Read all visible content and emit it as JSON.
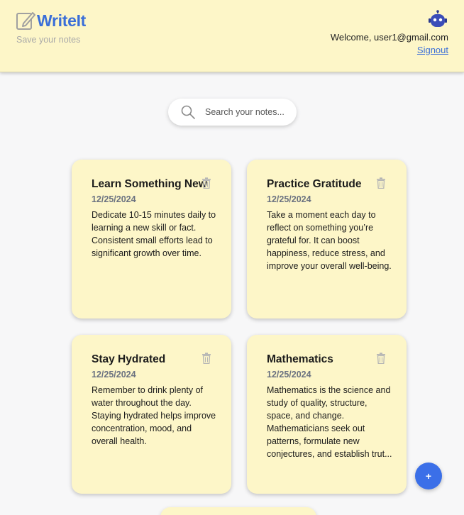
{
  "header": {
    "brand_title": "WriteIt",
    "tagline": "Save your notes",
    "welcome": "Welcome, user1@gmail.com",
    "signout_label": "Signout"
  },
  "search": {
    "placeholder": "Search your notes..."
  },
  "notes": [
    {
      "title": "Learn Something New",
      "date": "12/25/2024",
      "body": "Dedicate 10-15 minutes daily to learning a new skill or fact. Consistent small efforts lead to significant growth over time."
    },
    {
      "title": "Practice Gratitude",
      "date": "12/25/2024",
      "body": "Take a moment each day to reflect on something you’re grateful for. It can boost happiness, reduce stress, and improve your overall well-being."
    },
    {
      "title": "Stay Hydrated",
      "date": "12/25/2024",
      "body": "Remember to drink plenty of water throughout the day. Staying hydrated helps improve concentration, mood, and overall health."
    },
    {
      "title": "Mathematics",
      "date": "12/25/2024",
      "body": "Mathematics is the science and study of quality, structure, space, and change. Mathematicians seek out patterns, formulate new conjectures, and establish trut..."
    }
  ],
  "fab_label": "+",
  "icons": {
    "brand": "edit-note-icon",
    "avatar": "robot-avatar-icon",
    "search": "search-icon",
    "delete": "trash-icon"
  },
  "colors": {
    "accent": "#3b6fd8",
    "card_bg": "#fdf6c8",
    "header_bg": "#fdf6c8",
    "page_bg": "#f7f7f8",
    "fab": "#3b6fe8"
  }
}
